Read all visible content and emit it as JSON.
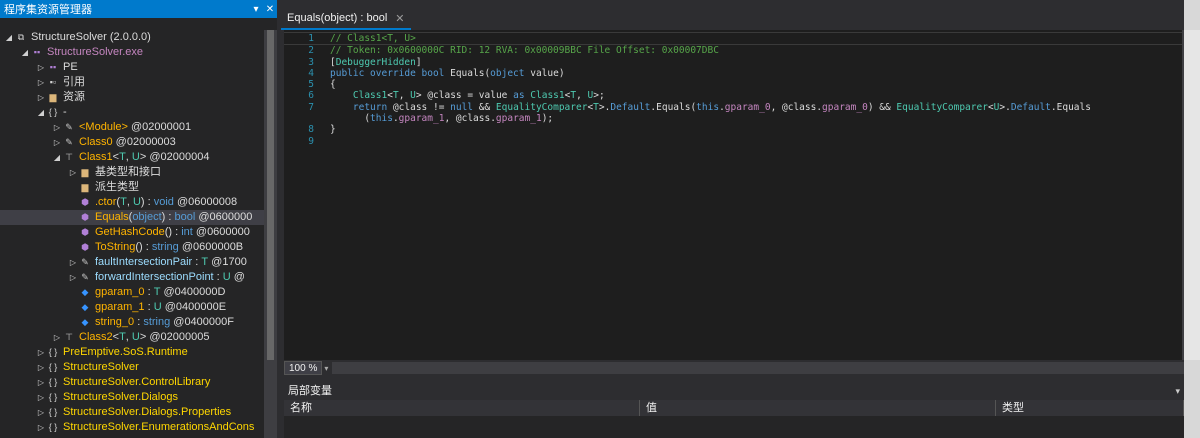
{
  "explorer": {
    "title": "程序集资源管理器",
    "pin": "▾",
    "close": "✕",
    "rows": [
      {
        "indent": 0,
        "exp": "◢",
        "icon": "assembly",
        "parts": [
          {
            "t": "StructureSolver (2.0.0.0)",
            "c": "t-white"
          }
        ]
      },
      {
        "indent": 1,
        "exp": "◢",
        "icon": "module",
        "parts": [
          {
            "t": "StructureSolver.exe",
            "c": "t-purple"
          }
        ]
      },
      {
        "indent": 2,
        "exp": "▷",
        "icon": "pe",
        "parts": [
          {
            "t": "PE",
            "c": "t-white"
          }
        ]
      },
      {
        "indent": 2,
        "exp": "▷",
        "icon": "refs",
        "parts": [
          {
            "t": "引用",
            "c": "t-white"
          }
        ]
      },
      {
        "indent": 2,
        "exp": "▷",
        "icon": "folder",
        "parts": [
          {
            "t": "资源",
            "c": "t-white"
          }
        ]
      },
      {
        "indent": 2,
        "exp": "◢",
        "icon": "ns",
        "parts": [
          {
            "t": "-",
            "c": "t-white"
          }
        ]
      },
      {
        "indent": 3,
        "exp": "▷",
        "icon": "class",
        "parts": [
          {
            "t": "<Module>",
            "c": "t-orange"
          },
          {
            "t": " @02000001",
            "c": "t-white"
          }
        ]
      },
      {
        "indent": 3,
        "exp": "▷",
        "icon": "class",
        "parts": [
          {
            "t": "Class0",
            "c": "t-orange"
          },
          {
            "t": " @02000003",
            "c": "t-white"
          }
        ]
      },
      {
        "indent": 3,
        "exp": "◢",
        "icon": "generic",
        "parts": [
          {
            "t": "Class1",
            "c": "t-orange"
          },
          {
            "t": "<",
            "c": "t-white"
          },
          {
            "t": "T",
            "c": "t-type"
          },
          {
            "t": ", ",
            "c": "t-white"
          },
          {
            "t": "U",
            "c": "t-type"
          },
          {
            "t": "> @02000004",
            "c": "t-white"
          }
        ]
      },
      {
        "indent": 4,
        "exp": "▷",
        "icon": "folder",
        "parts": [
          {
            "t": "基类型和接口",
            "c": "t-white"
          }
        ]
      },
      {
        "indent": 4,
        "exp": "",
        "icon": "folder",
        "parts": [
          {
            "t": "派生类型",
            "c": "t-white"
          }
        ]
      },
      {
        "indent": 4,
        "exp": "",
        "icon": "method",
        "parts": [
          {
            "t": ".ctor",
            "c": "t-orange"
          },
          {
            "t": "(",
            "c": "t-white"
          },
          {
            "t": "T",
            "c": "t-type"
          },
          {
            "t": ", ",
            "c": "t-white"
          },
          {
            "t": "U",
            "c": "t-type"
          },
          {
            "t": ") : ",
            "c": "t-white"
          },
          {
            "t": "void",
            "c": "t-kw"
          },
          {
            "t": " @06000008",
            "c": "t-white"
          }
        ]
      },
      {
        "indent": 4,
        "exp": "",
        "icon": "method",
        "selected": true,
        "parts": [
          {
            "t": "Equals",
            "c": "t-orange"
          },
          {
            "t": "(",
            "c": "t-white"
          },
          {
            "t": "object",
            "c": "t-kw"
          },
          {
            "t": ") : ",
            "c": "t-white"
          },
          {
            "t": "bool",
            "c": "t-kw"
          },
          {
            "t": " @0600000",
            "c": "t-white"
          }
        ]
      },
      {
        "indent": 4,
        "exp": "",
        "icon": "method",
        "parts": [
          {
            "t": "GetHashCode",
            "c": "t-orange"
          },
          {
            "t": "() : ",
            "c": "t-white"
          },
          {
            "t": "int",
            "c": "t-kw"
          },
          {
            "t": " @0600000",
            "c": "t-white"
          }
        ]
      },
      {
        "indent": 4,
        "exp": "",
        "icon": "method",
        "parts": [
          {
            "t": "ToString",
            "c": "t-orange"
          },
          {
            "t": "() : ",
            "c": "t-white"
          },
          {
            "t": "string",
            "c": "t-kw"
          },
          {
            "t": " @0600000B",
            "c": "t-white"
          }
        ]
      },
      {
        "indent": 4,
        "exp": "▷",
        "icon": "prop",
        "parts": [
          {
            "t": "faultIntersectionPair",
            "c": "t-green"
          },
          {
            "t": " : ",
            "c": "t-white"
          },
          {
            "t": "T",
            "c": "t-type"
          },
          {
            "t": " @1700",
            "c": "t-white"
          }
        ]
      },
      {
        "indent": 4,
        "exp": "▷",
        "icon": "prop",
        "parts": [
          {
            "t": "forwardIntersectionPoint",
            "c": "t-green"
          },
          {
            "t": " : ",
            "c": "t-white"
          },
          {
            "t": "U",
            "c": "t-type"
          },
          {
            "t": " @",
            "c": "t-white"
          }
        ]
      },
      {
        "indent": 4,
        "exp": "",
        "icon": "field",
        "parts": [
          {
            "t": "gparam_0",
            "c": "t-orange"
          },
          {
            "t": " : ",
            "c": "t-white"
          },
          {
            "t": "T",
            "c": "t-type"
          },
          {
            "t": " @0400000D",
            "c": "t-white"
          }
        ]
      },
      {
        "indent": 4,
        "exp": "",
        "icon": "field",
        "parts": [
          {
            "t": "gparam_1",
            "c": "t-orange"
          },
          {
            "t": " : ",
            "c": "t-white"
          },
          {
            "t": "U",
            "c": "t-type"
          },
          {
            "t": " @0400000E",
            "c": "t-white"
          }
        ]
      },
      {
        "indent": 4,
        "exp": "",
        "icon": "field",
        "parts": [
          {
            "t": "string_0",
            "c": "t-orange"
          },
          {
            "t": " : ",
            "c": "t-white"
          },
          {
            "t": "string",
            "c": "t-kw"
          },
          {
            "t": " @0400000F",
            "c": "t-white"
          }
        ]
      },
      {
        "indent": 3,
        "exp": "▷",
        "icon": "generic",
        "parts": [
          {
            "t": "Class2",
            "c": "t-orange"
          },
          {
            "t": "<",
            "c": "t-white"
          },
          {
            "t": "T",
            "c": "t-type"
          },
          {
            "t": ", ",
            "c": "t-white"
          },
          {
            "t": "U",
            "c": "t-type"
          },
          {
            "t": "> @02000005",
            "c": "t-white"
          }
        ]
      },
      {
        "indent": 2,
        "exp": "▷",
        "icon": "ns",
        "parts": [
          {
            "t": "PreEmptive.SoS.Runtime",
            "c": "t-ns"
          }
        ]
      },
      {
        "indent": 2,
        "exp": "▷",
        "icon": "ns",
        "parts": [
          {
            "t": "StructureSolver",
            "c": "t-ns"
          }
        ]
      },
      {
        "indent": 2,
        "exp": "▷",
        "icon": "ns",
        "parts": [
          {
            "t": "StructureSolver.ControlLibrary",
            "c": "t-ns"
          }
        ]
      },
      {
        "indent": 2,
        "exp": "▷",
        "icon": "ns",
        "parts": [
          {
            "t": "StructureSolver.Dialogs",
            "c": "t-ns"
          }
        ]
      },
      {
        "indent": 2,
        "exp": "▷",
        "icon": "ns",
        "parts": [
          {
            "t": "StructureSolver.Dialogs.Properties",
            "c": "t-ns"
          }
        ]
      },
      {
        "indent": 2,
        "exp": "▷",
        "icon": "ns",
        "parts": [
          {
            "t": "StructureSolver.EnumerationsAndCons",
            "c": "t-ns"
          }
        ]
      }
    ]
  },
  "tab": {
    "label": "Equals(object) : bool",
    "close": "✕"
  },
  "editor": {
    "lines": [
      {
        "n": "1",
        "cur": true,
        "parts": [
          {
            "t": "// Class1<T, U>",
            "c": "c-com"
          }
        ]
      },
      {
        "n": "2",
        "parts": [
          {
            "t": "// Token: 0x0600000C RID: 12 RVA: 0x00009BBC File Offset: 0x00007DBC",
            "c": "c-com"
          }
        ]
      },
      {
        "n": "3",
        "parts": [
          {
            "t": "[",
            "c": "code"
          },
          {
            "t": "DebuggerHidden",
            "c": "c-type"
          },
          {
            "t": "]",
            "c": "code"
          }
        ]
      },
      {
        "n": "4",
        "parts": [
          {
            "t": "public override bool ",
            "c": "c-kw"
          },
          {
            "t": "Equals",
            "c": "code"
          },
          {
            "t": "(",
            "c": "code"
          },
          {
            "t": "object ",
            "c": "c-kw"
          },
          {
            "t": "value",
            "c": "code"
          },
          {
            "t": ")",
            "c": "code"
          }
        ]
      },
      {
        "n": "5",
        "parts": [
          {
            "t": "{",
            "c": "code"
          }
        ]
      },
      {
        "n": "6",
        "parts": [
          {
            "t": "    ",
            "c": "code"
          },
          {
            "t": "Class1",
            "c": "c-type"
          },
          {
            "t": "<",
            "c": "code"
          },
          {
            "t": "T",
            "c": "c-type"
          },
          {
            "t": ", ",
            "c": "code"
          },
          {
            "t": "U",
            "c": "c-type"
          },
          {
            "t": "> @class = ",
            "c": "code"
          },
          {
            "t": "value",
            "c": "code"
          },
          {
            "t": " as ",
            "c": "c-kw"
          },
          {
            "t": "Class1",
            "c": "c-type"
          },
          {
            "t": "<",
            "c": "code"
          },
          {
            "t": "T",
            "c": "c-type"
          },
          {
            "t": ", ",
            "c": "code"
          },
          {
            "t": "U",
            "c": "c-type"
          },
          {
            "t": ">;",
            "c": "code"
          }
        ]
      },
      {
        "n": "7",
        "parts": [
          {
            "t": "    ",
            "c": "code"
          },
          {
            "t": "return ",
            "c": "c-kw"
          },
          {
            "t": "@class != ",
            "c": "code"
          },
          {
            "t": "null",
            "c": "c-kw"
          },
          {
            "t": " && ",
            "c": "code"
          },
          {
            "t": "EqualityComparer",
            "c": "c-type"
          },
          {
            "t": "<",
            "c": "code"
          },
          {
            "t": "T",
            "c": "c-type"
          },
          {
            "t": ">.",
            "c": "code"
          },
          {
            "t": "Default",
            "c": "c-kw"
          },
          {
            "t": ".Equals(",
            "c": "code"
          },
          {
            "t": "this",
            "c": "c-kw"
          },
          {
            "t": ".",
            "c": "code"
          },
          {
            "t": "gparam_0",
            "c": "c-fld"
          },
          {
            "t": ", @class.",
            "c": "code"
          },
          {
            "t": "gparam_0",
            "c": "c-fld"
          },
          {
            "t": ") && ",
            "c": "code"
          },
          {
            "t": "EqualityComparer",
            "c": "c-type"
          },
          {
            "t": "<",
            "c": "code"
          },
          {
            "t": "U",
            "c": "c-type"
          },
          {
            "t": ">.",
            "c": "code"
          },
          {
            "t": "Default",
            "c": "c-kw"
          },
          {
            "t": ".Equals",
            "c": "code"
          }
        ]
      },
      {
        "n": "",
        "parts": [
          {
            "t": "      (",
            "c": "code"
          },
          {
            "t": "this",
            "c": "c-kw"
          },
          {
            "t": ".",
            "c": "code"
          },
          {
            "t": "gparam_1",
            "c": "c-fld"
          },
          {
            "t": ", @class.",
            "c": "code"
          },
          {
            "t": "gparam_1",
            "c": "c-fld"
          },
          {
            "t": ");",
            "c": "code"
          }
        ]
      },
      {
        "n": "8",
        "parts": [
          {
            "t": "}",
            "c": "code"
          }
        ]
      },
      {
        "n": "9",
        "parts": [
          {
            "t": "",
            "c": "code"
          }
        ]
      }
    ]
  },
  "zoom": {
    "value": "100 %",
    "caret": "▾"
  },
  "locals": {
    "title": "局部变量",
    "dropdown": "▾",
    "columns": [
      "名称",
      "值",
      "类型"
    ]
  }
}
